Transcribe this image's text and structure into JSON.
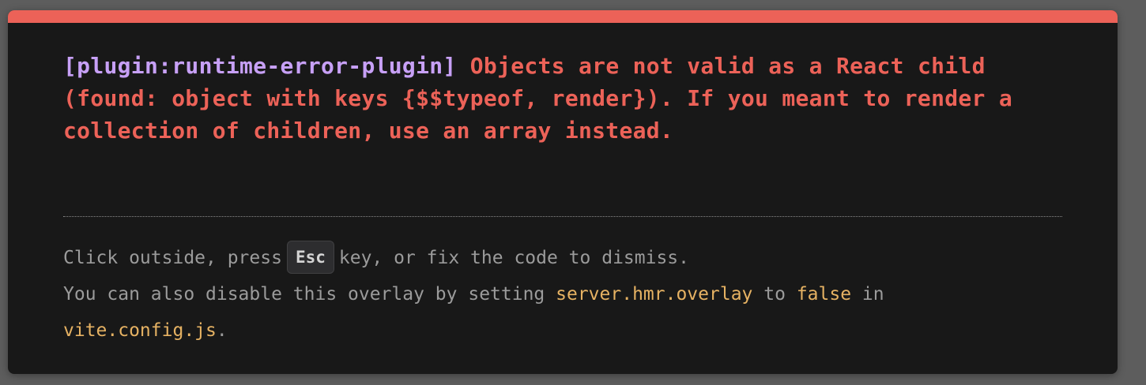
{
  "overlay": {
    "plugin_label": "[plugin:runtime-error-plugin]",
    "error_message": "Objects are not valid as a React child (found: object with keys {$$typeof, render}). If you meant to render a collection of children, use an array instead.",
    "tip": {
      "line1_before": "Click outside, press",
      "key": "Esc",
      "line1_after": "key, or fix the code to dismiss.",
      "line2_before": "You can also disable this overlay by setting",
      "setting_name": "server.hmr.overlay",
      "line2_mid": "to",
      "setting_value": "false",
      "line2_after": "in",
      "config_file": "vite.config.js",
      "line3_after": "."
    }
  },
  "colors": {
    "backdrop": "#5d5d5d",
    "panel": "#181818",
    "error_red": "#ec6258",
    "plugin_purple": "#c7a0f6",
    "tip_gray": "#9b9b9b",
    "code_yellow": "#e6b263"
  }
}
